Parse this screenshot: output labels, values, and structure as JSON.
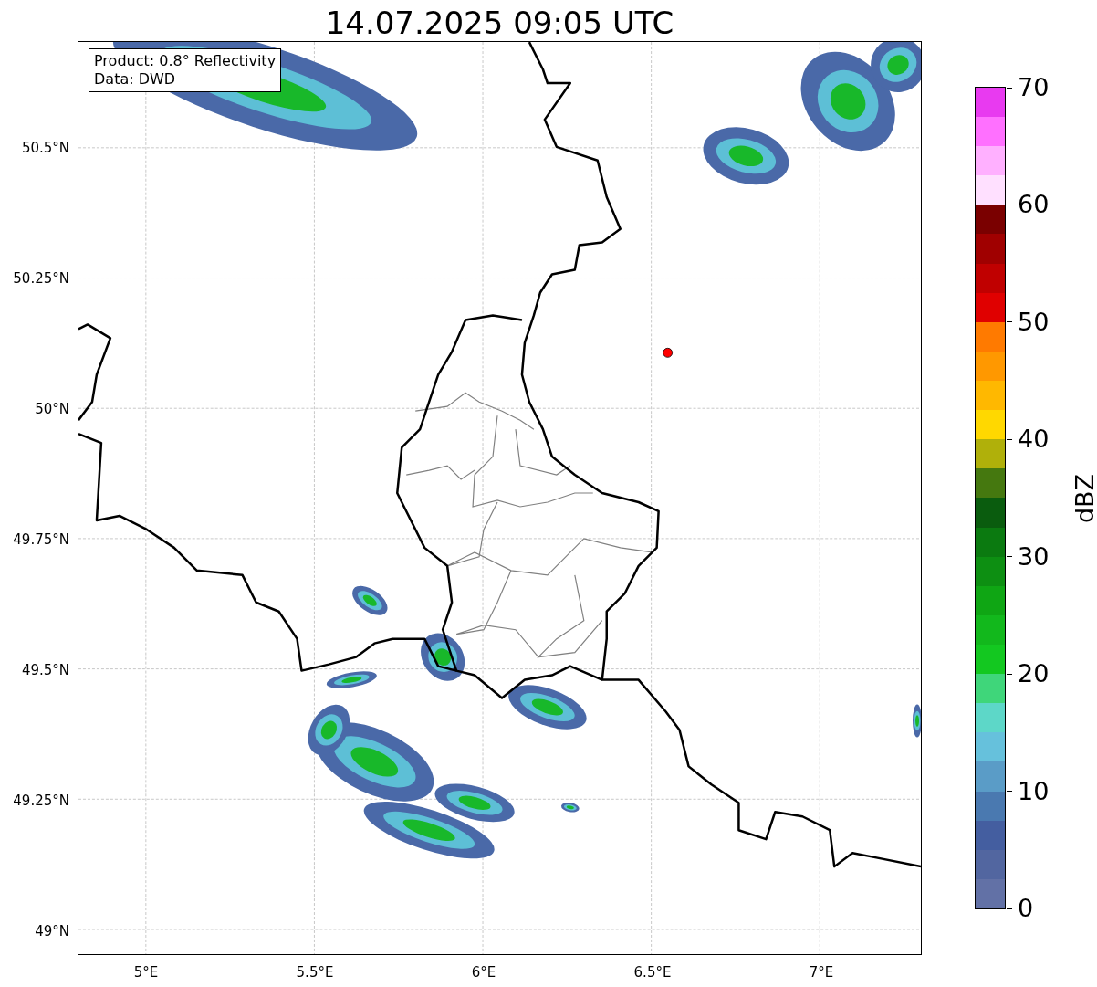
{
  "title": "14.07.2025 09:05 UTC",
  "map": {
    "annotation": [
      "Product: 0.8° Reflectivity",
      "Data: DWD"
    ],
    "xticks": [
      "5°E",
      "5.5°E",
      "6°E",
      "6.5°E",
      "7°E"
    ],
    "yticks": [
      "50.5°N",
      "50.25°N",
      "50°N",
      "49.75°N",
      "49.5°N",
      "49.25°N",
      "49°N"
    ]
  },
  "colorbar": {
    "label": "dBZ",
    "ticks": [
      "70",
      "60",
      "50",
      "40",
      "30",
      "20",
      "10",
      "0"
    ],
    "segments": [
      {
        "color": "#6271a6"
      },
      {
        "color": "#5266a0"
      },
      {
        "color": "#445ea0"
      },
      {
        "color": "#4a79b0"
      },
      {
        "color": "#5a9cc7"
      },
      {
        "color": "#66c1dc"
      },
      {
        "color": "#5dd7c8"
      },
      {
        "color": "#3fd67a"
      },
      {
        "color": "#13c820"
      },
      {
        "color": "#12b81c"
      },
      {
        "color": "#0fa614"
      },
      {
        "color": "#0d8f12"
      },
      {
        "color": "#0b7a10"
      },
      {
        "color": "#0a5c0e"
      },
      {
        "color": "#45780f"
      },
      {
        "color": "#b0b00a"
      },
      {
        "color": "#ffd800"
      },
      {
        "color": "#ffb800"
      },
      {
        "color": "#ff9800"
      },
      {
        "color": "#ff7a00"
      },
      {
        "color": "#e00000"
      },
      {
        "color": "#c00000"
      },
      {
        "color": "#a00000"
      },
      {
        "color": "#7a0000"
      },
      {
        "color": "#ffe0ff"
      },
      {
        "color": "#ffb0ff"
      },
      {
        "color": "#ff70ff"
      },
      {
        "color": "#e83af0"
      }
    ]
  }
}
